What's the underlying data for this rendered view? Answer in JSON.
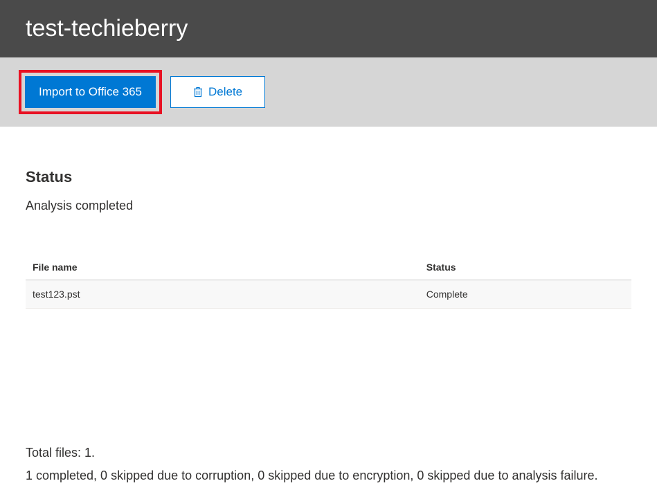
{
  "header": {
    "title": "test-techieberry"
  },
  "toolbar": {
    "import_label": "Import to Office 365",
    "delete_label": "Delete"
  },
  "status": {
    "heading": "Status",
    "text": "Analysis completed"
  },
  "table": {
    "headers": {
      "filename": "File name",
      "status": "Status"
    },
    "rows": [
      {
        "filename": "test123.pst",
        "status": "Complete"
      }
    ]
  },
  "summary": {
    "total_line": "Total files: 1.",
    "details_line": "1 completed, 0 skipped due to corruption, 0 skipped due to encryption, 0 skipped due to analysis failure."
  }
}
